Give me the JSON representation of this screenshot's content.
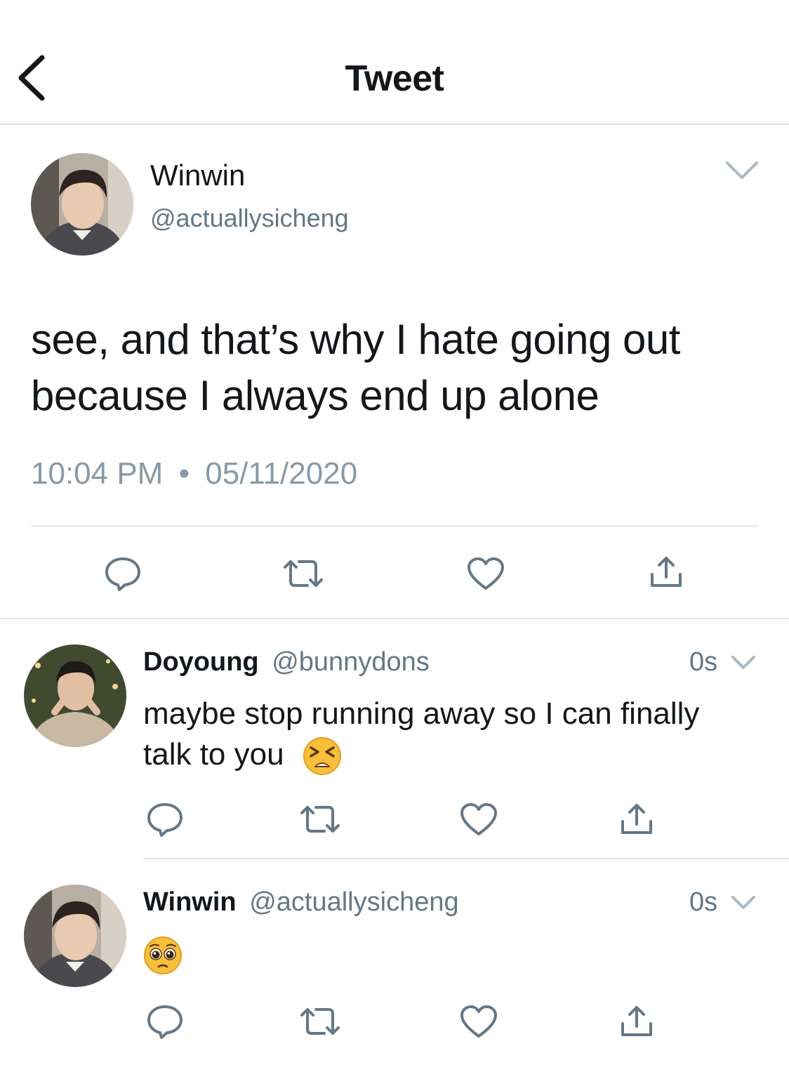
{
  "header": {
    "title": "Tweet"
  },
  "main_tweet": {
    "name": "Winwin",
    "handle": "@actuallysicheng",
    "text": "see, and that’s why I hate going out because I always end up alone",
    "time": "10:04 PM",
    "separator": "•",
    "date": "05/11/2020"
  },
  "replies": [
    {
      "name": "Doyoung",
      "handle": "@bunnydons",
      "time": "0s",
      "text": "maybe stop running away so I can finally talk to you",
      "emoji": "tired-face-emoji"
    },
    {
      "name": "Winwin",
      "handle": "@actuallysicheng",
      "time": "0s",
      "text": "",
      "emoji": "pleading-face-emoji"
    }
  ],
  "colors": {
    "text": "#14171a",
    "secondary": "#657786",
    "meta": "#8899a6",
    "divider": "#e1e8ed",
    "icon": "#657786"
  }
}
